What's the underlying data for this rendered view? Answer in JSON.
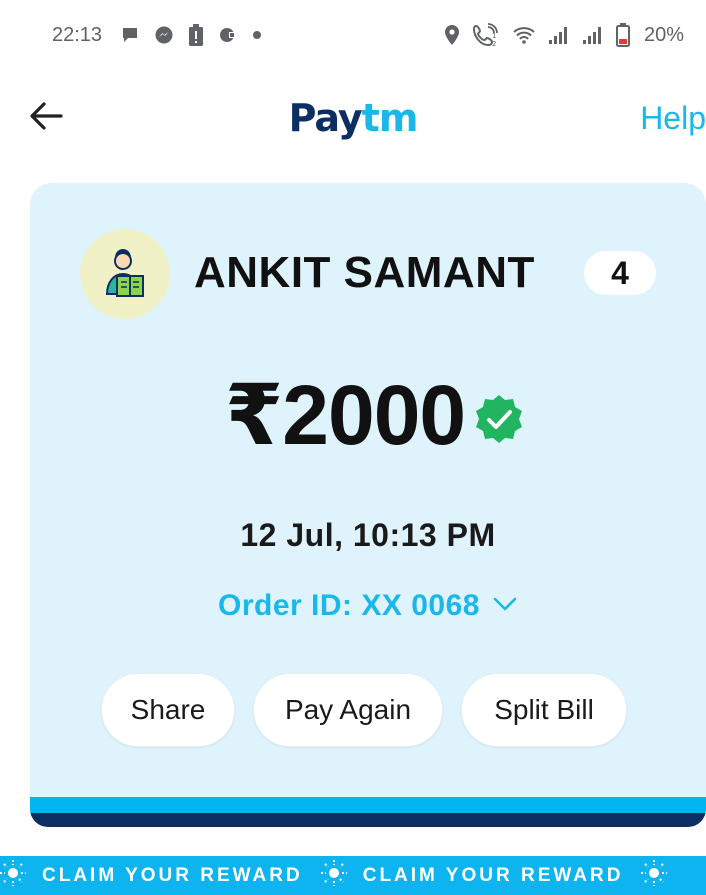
{
  "status_bar": {
    "time": "22:13",
    "battery": "20%",
    "icons_left": [
      "chat-bubble-icon",
      "messenger-icon",
      "battery-saver-icon",
      "app-notification-icon",
      "dot-icon"
    ],
    "icons_right": [
      "location-icon",
      "wifi-calling-icon",
      "wifi-icon",
      "signal-icon",
      "signal-icon",
      "battery-icon"
    ]
  },
  "header": {
    "logo_part1": "Pay",
    "logo_part2": "tm",
    "help_label": "Help",
    "back_icon": "arrow-left-icon"
  },
  "transaction": {
    "payee_name": "ANKIT SAMANT",
    "count_badge": "4",
    "amount": "₹2000",
    "verified_icon": "verified-check-icon",
    "datetime": "12 Jul, 10:13 PM",
    "order_id": "Order ID: XX 0068"
  },
  "actions": {
    "share": "Share",
    "pay_again": "Pay Again",
    "split_bill": "Split Bill"
  },
  "banner": {
    "reward_text": "CLAIM YOUR REWARD"
  },
  "colors": {
    "brand_dark": "#0b2e63",
    "brand_light": "#1ab7ea",
    "card_bg": "#dff3fd",
    "verified_green": "#21b561"
  }
}
